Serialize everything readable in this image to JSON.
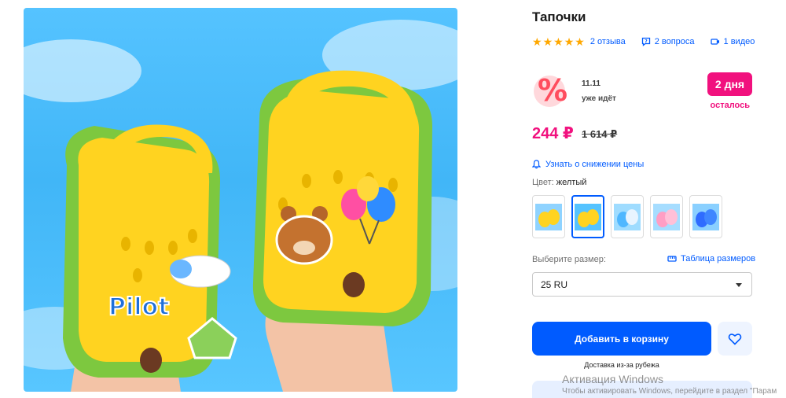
{
  "product": {
    "title": "Тапочки",
    "reviews": "2 отзыва",
    "questions": "2 вопроса",
    "video": "1 видео"
  },
  "promo": {
    "date": "11.11",
    "status": "уже идёт",
    "days_badge": "2 дня",
    "days_left": "осталось"
  },
  "price": {
    "current": "244 ₽",
    "old": "1 614 ₽"
  },
  "notify_link": "Узнать о снижении цены",
  "color": {
    "label": "Цвет: ",
    "value": "желтый"
  },
  "size": {
    "label": "Выберите размер:",
    "table_link": "Таблица размеров",
    "selected": "25 RU"
  },
  "actions": {
    "add_to_cart": "Добавить в корзину",
    "delivery": "Доставка из-за рубежа"
  },
  "watermark": {
    "title": "Активация Windows",
    "subtitle": "Чтобы активировать Windows, перейдите в раздел \"Парам"
  },
  "colors": {
    "accent": "#005bff",
    "sale": "#f1117e",
    "star": "#ffa800"
  },
  "photo_logo_text": "Pilot"
}
